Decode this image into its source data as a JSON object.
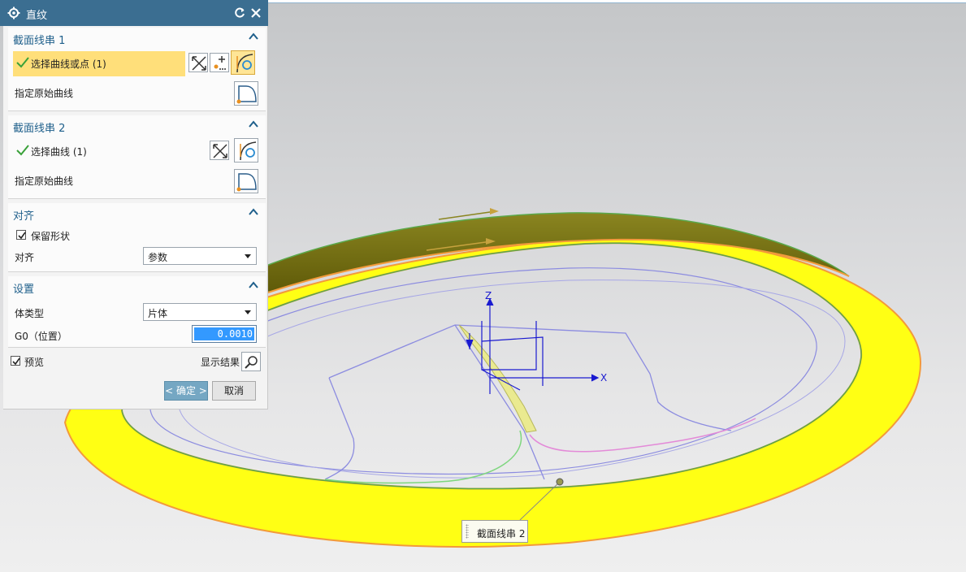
{
  "dialog": {
    "title": "直纹",
    "section1": {
      "title": "截面线串 1",
      "select_label": "选择曲线或点 (1)",
      "origin_label": "指定原始曲线"
    },
    "section2": {
      "title": "截面线串 2",
      "select_label": "选择曲线 (1)",
      "origin_label": "指定原始曲线"
    },
    "align": {
      "title": "对齐",
      "keep_shape_label": "保留形状",
      "keep_shape_checked": true,
      "align_label": "对齐",
      "align_value": "参数"
    },
    "settings": {
      "title": "设置",
      "body_type_label": "体类型",
      "body_type_value": "片体",
      "g0_label": "G0（位置）",
      "g0_value": "0.0010"
    },
    "preview_label": "预览",
    "preview_checked": true,
    "show_result_label": "显示结果",
    "ok_label": "< 确定 >",
    "cancel_label": "取消"
  },
  "viewport": {
    "axis_x_label": "X",
    "axis_z_label": "Z",
    "tooltip_label": "截面线串 2"
  },
  "colors": {
    "titlebar": "#3b6e91",
    "section_title": "#1e5f8b",
    "highlight": "#ffdf7a",
    "surface_yellow": "#ffff14",
    "surface_olive": "#6e6a10",
    "edge_orange": "#f39a3a",
    "curve_blue": "#8c8ce0",
    "axis_blue": "#1a1ad0"
  }
}
